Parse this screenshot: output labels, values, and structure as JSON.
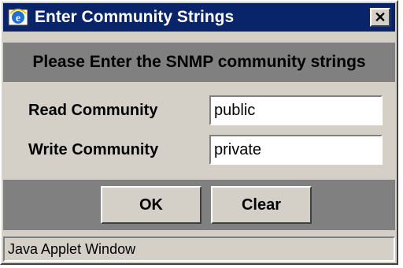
{
  "window": {
    "title": "Enter Community Strings",
    "close_glyph": "✕",
    "icon": "ie-applet-icon"
  },
  "header": {
    "text": "Please Enter the SNMP community strings"
  },
  "form": {
    "read_label": "Read Community",
    "read_value": "public",
    "write_label": "Write Community",
    "write_value": "private"
  },
  "buttons": {
    "ok_label": "OK",
    "clear_label": "Clear"
  },
  "status": {
    "text": "Java Applet Window"
  },
  "colors": {
    "title_bar": "#0a246a",
    "dialog_face": "#d4d0c8",
    "band": "#808080"
  }
}
